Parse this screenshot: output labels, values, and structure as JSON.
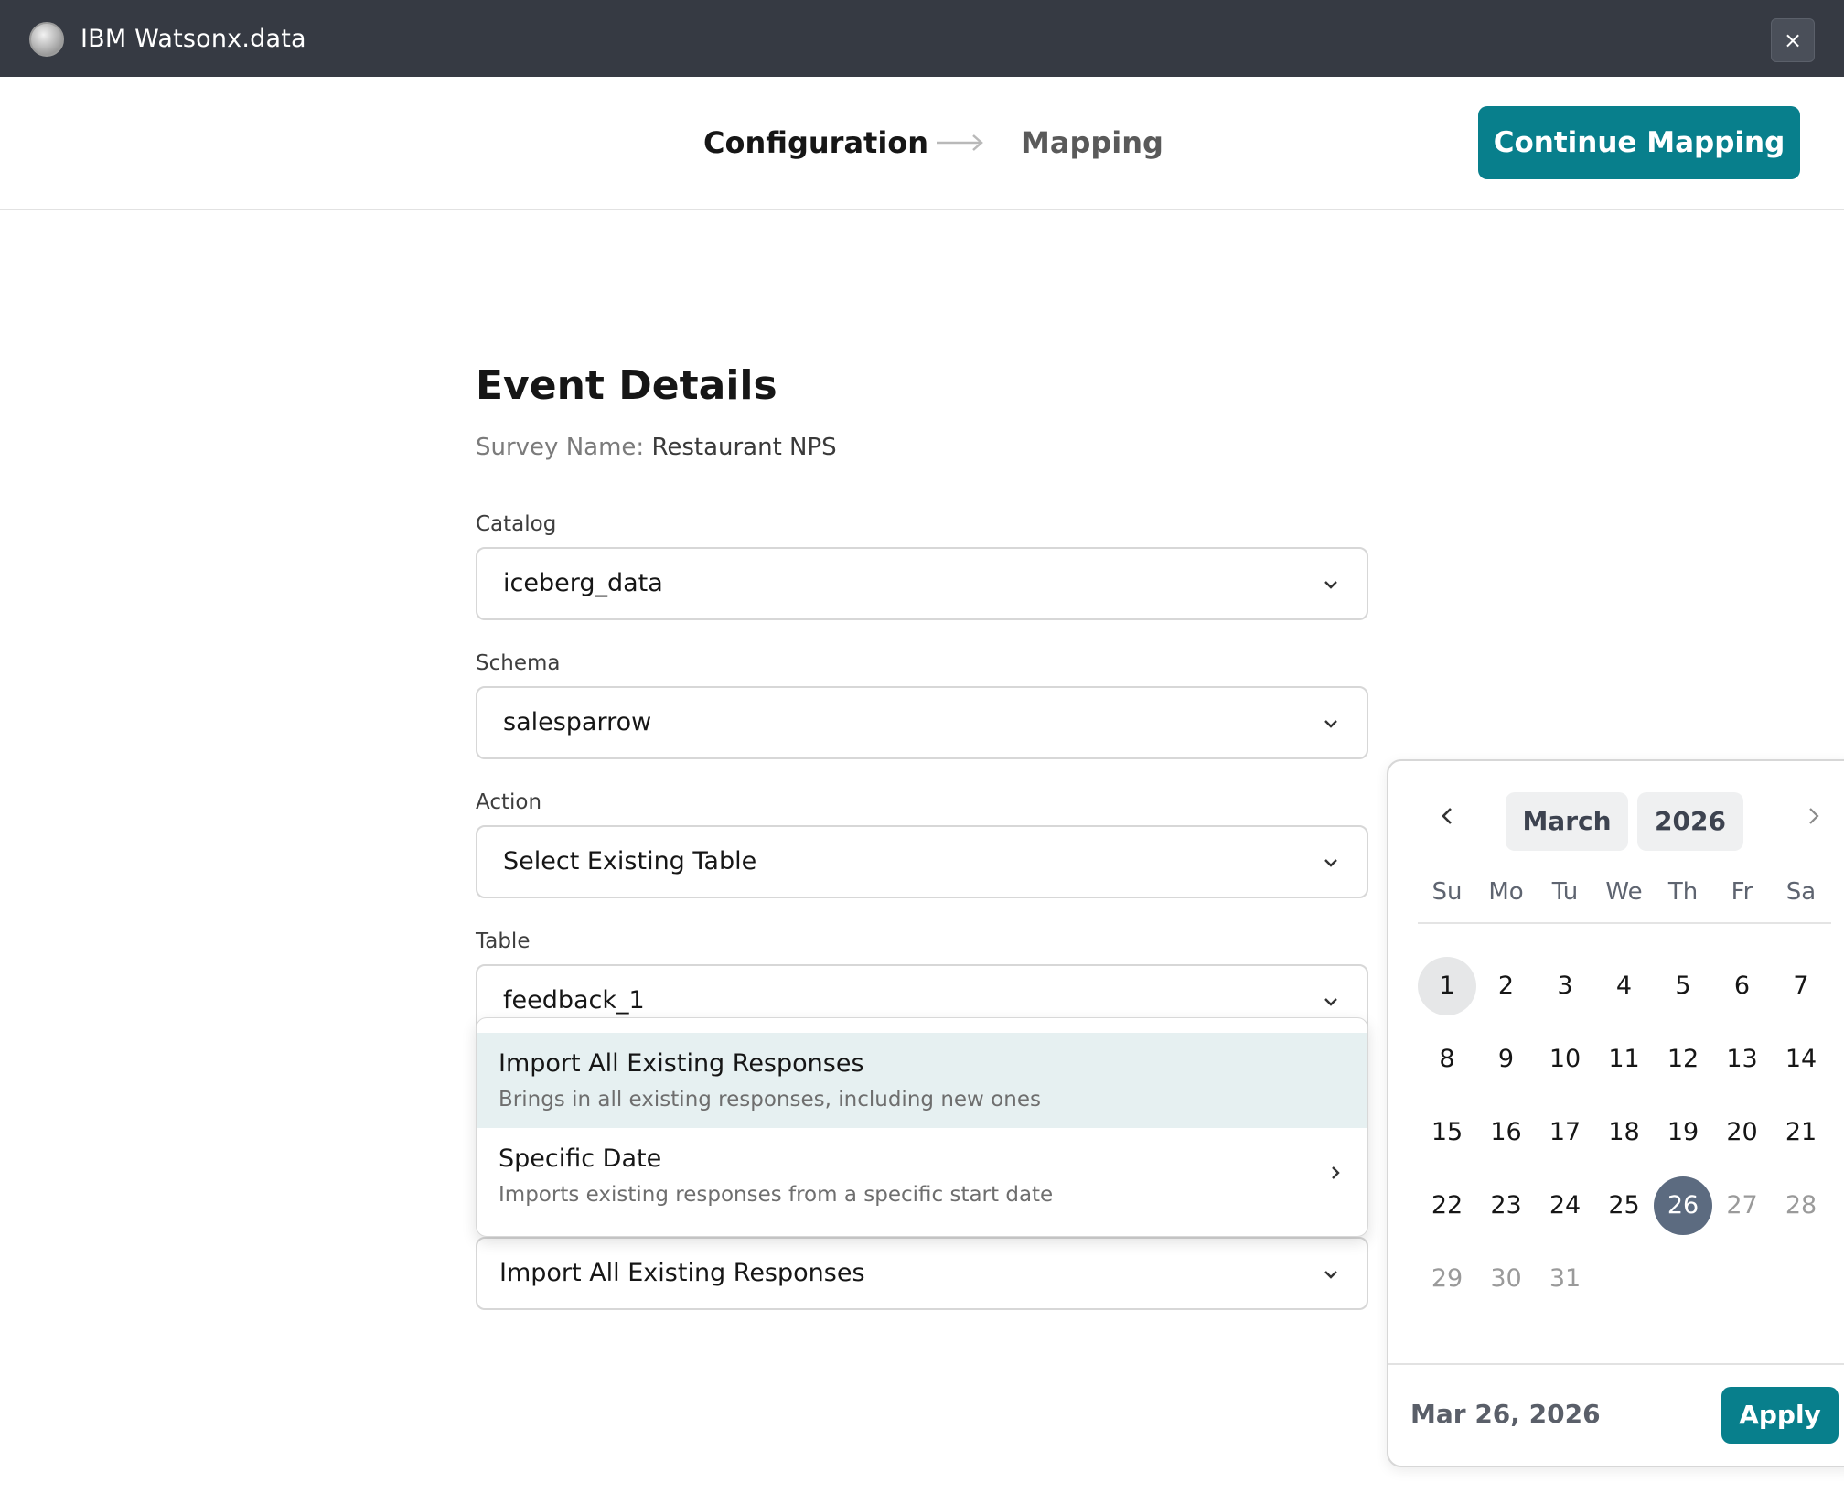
{
  "app": {
    "title": "IBM Watsonx.data",
    "close_label": "×"
  },
  "steps": {
    "configuration": "Configuration",
    "mapping": "Mapping"
  },
  "actions": {
    "continue_label": "Continue Mapping"
  },
  "form": {
    "title": "Event Details",
    "survey_key": "Survey Name:",
    "survey_value": "Restaurant NPS",
    "catalog": {
      "label": "Catalog",
      "value": "iceberg_data"
    },
    "schema": {
      "label": "Schema",
      "value": "salesparrow"
    },
    "action": {
      "label": "Action",
      "value": "Select Existing Table"
    },
    "table": {
      "label": "Table",
      "value": "feedback_1"
    },
    "import": {
      "value": "Import All Existing Responses"
    }
  },
  "dropdown": {
    "items": [
      {
        "title": "Import All Existing Responses",
        "subtitle": "Brings in all existing responses, including new ones"
      },
      {
        "title": "Specific Date",
        "subtitle": "Imports existing responses from a specific start date"
      }
    ]
  },
  "calendar": {
    "month": "March",
    "year": "2026",
    "weekdays": [
      "Su",
      "Mo",
      "Tu",
      "We",
      "Th",
      "Fr",
      "Sa"
    ],
    "days": [
      "1",
      "2",
      "3",
      "4",
      "5",
      "6",
      "7",
      "8",
      "9",
      "10",
      "11",
      "12",
      "13",
      "14",
      "15",
      "16",
      "17",
      "18",
      "19",
      "20",
      "21",
      "22",
      "23",
      "24",
      "25",
      "26",
      "27",
      "28",
      "29",
      "30",
      "31"
    ],
    "today": "1",
    "selected": "26",
    "selected_label": "Mar 26, 2026",
    "apply_label": "Apply"
  },
  "colors": {
    "topbar": "#363a43",
    "accent": "#087f8c",
    "selected_day": "#5c6b80",
    "active_option": "#e6f0f1"
  }
}
